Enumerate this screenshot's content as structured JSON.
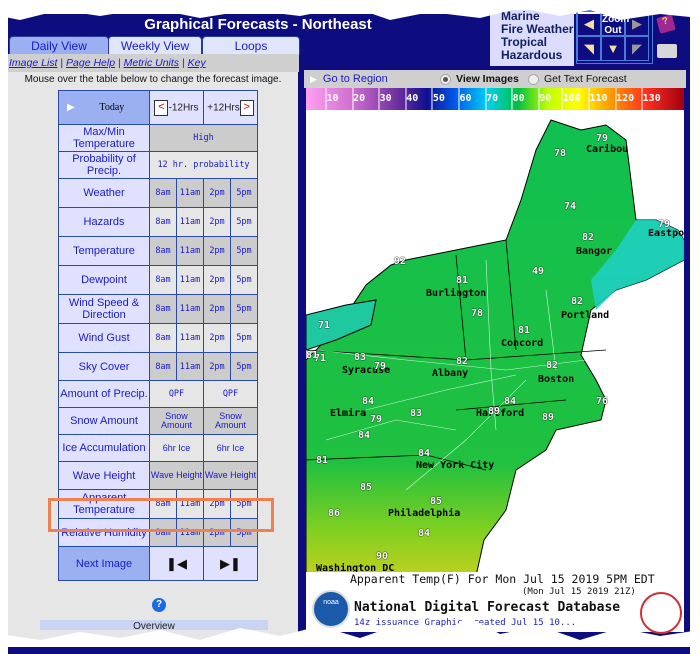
{
  "header": {
    "title": "Graphical Forecasts - Northeast",
    "tabs": [
      {
        "label": "Daily View",
        "active": true
      },
      {
        "label": "Weekly View",
        "active": false
      },
      {
        "label": "Loops",
        "active": false
      }
    ],
    "links": [
      "Image List",
      "Page Help",
      "Metric Units",
      "Key"
    ],
    "regions": [
      "Marine",
      "Fire Weather",
      "Tropical",
      "Hazardous"
    ],
    "zoom_label": "Zoom Out"
  },
  "panel": {
    "instruction": "Mouse over the table below to change the forecast image.",
    "nav": {
      "today": "Today",
      "minus": "-12Hrs",
      "plus": "+12Hrs"
    },
    "rows": [
      {
        "label": "Max/Min Temperature",
        "cells": [
          "High"
        ]
      },
      {
        "label": "Probability of Precip.",
        "cells": [
          "12 hr. probability"
        ]
      },
      {
        "label": "Weather",
        "cells": [
          "8am",
          "11am",
          "2pm",
          "5pm"
        ]
      },
      {
        "label": "Hazards",
        "cells": [
          "8am",
          "11am",
          "2pm",
          "5pm"
        ]
      },
      {
        "label": "Temperature",
        "cells": [
          "8am",
          "11am",
          "2pm",
          "5pm"
        ]
      },
      {
        "label": "Dewpoint",
        "cells": [
          "8am",
          "11am",
          "2pm",
          "5pm"
        ]
      },
      {
        "label": "Wind Speed & Direction",
        "cells": [
          "8am",
          "11am",
          "2pm",
          "5pm"
        ]
      },
      {
        "label": "Wind Gust",
        "cells": [
          "8am",
          "11am",
          "2pm",
          "5pm"
        ]
      },
      {
        "label": "Sky Cover",
        "cells": [
          "8am",
          "11am",
          "2pm",
          "5pm"
        ]
      },
      {
        "label": "Amount of Precip.",
        "cells": [
          "QPF",
          "QPF"
        ]
      },
      {
        "label": "Snow Amount",
        "cells": [
          "Snow Amount",
          "Snow Amount"
        ]
      },
      {
        "label": "Ice Accumulation",
        "cells": [
          "6hr Ice",
          "6hr Ice"
        ]
      },
      {
        "label": "Wave Height",
        "cells": [
          "Wave Height",
          "Wave Height"
        ]
      },
      {
        "label": "Apparent Temperature",
        "cells": [
          "8am",
          "11am",
          "2pm",
          "5pm"
        ],
        "highlighted": true
      },
      {
        "label": "Relative Humidity",
        "cells": [
          "8am",
          "11am",
          "2pm",
          "5pm"
        ]
      }
    ],
    "next_image": "Next Image",
    "first_icon": "skip-back-icon",
    "last_icon": "skip-forward-icon",
    "help_icon": "?",
    "overview": "Overview"
  },
  "toolbar": {
    "go_region": "Go to Region",
    "view_images": "View Images",
    "get_text": "Get Text Forecast",
    "view_mode": "View Images"
  },
  "scale": {
    "ticks": [
      "10",
      "20",
      "30",
      "40",
      "50",
      "60",
      "70",
      "80",
      "90",
      "100",
      "110",
      "120",
      "130"
    ]
  },
  "map": {
    "cities": [
      {
        "name": "Caribou",
        "temp": "79"
      },
      {
        "name": "Bangor",
        "temp": "82"
      },
      {
        "name": "Eastport",
        "temp": "79"
      },
      {
        "name": "Burlington",
        "temp": "81"
      },
      {
        "name": "Portland",
        "temp": "82"
      },
      {
        "name": "Concord",
        "temp": "81"
      },
      {
        "name": "Boston",
        "temp": "82"
      },
      {
        "name": "Syracuse",
        "temp": "83"
      },
      {
        "name": "Albany",
        "temp": "82"
      },
      {
        "name": "Hartford",
        "temp": "84"
      },
      {
        "name": "Elmira",
        "temp": "84"
      },
      {
        "name": "New York City",
        "temp": "84"
      },
      {
        "name": "Philadelphia",
        "temp": "85"
      },
      {
        "name": "Washington DC",
        "temp": "90"
      }
    ],
    "points": [
      "78",
      "74",
      "92",
      "49",
      "78",
      "71",
      "71",
      "81",
      "79",
      "79",
      "89",
      "76",
      "83",
      "89",
      "84",
      "81",
      "85",
      "86",
      "84"
    ]
  },
  "footer": {
    "title": "Apparent Temp(F) For Mon Jul 15 2019  5PM EDT",
    "subtitle": "(Mon Jul 15 2019 21Z)",
    "database": "National Digital Forecast Database",
    "issuance": "14z issuance    Graphic created Jul 15 10..."
  },
  "colors": {
    "frame": "#0d0d80",
    "link": "#1a1ac8",
    "highlight": "#f08050",
    "panel": "#e6e6e6"
  }
}
